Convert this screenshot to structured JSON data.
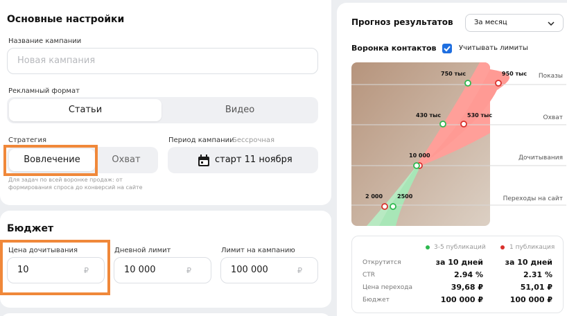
{
  "basic": {
    "title": "Основные настройки",
    "campaign_name_label": "Название кампании",
    "campaign_name_placeholder": "Новая кампания",
    "ad_format_label": "Рекламный формат",
    "format_options": [
      "Статьи",
      "Видео"
    ],
    "strategy_label": "Стратегия",
    "strategy_options": [
      "Вовлечение",
      "Охват"
    ],
    "strategy_hint": "Для задач по всей воронке продаж: от формирования спроса до конверсий на сайте",
    "period_label": "Период кампании",
    "period_sublabel": "Бессрочная",
    "period_button": "старт 11 ноября"
  },
  "budget": {
    "title": "Бюджет",
    "read_price_label": "Цена дочитывания",
    "read_price_value": "10",
    "daily_limit_label": "Дневной лимит",
    "daily_limit_value": "10 000",
    "campaign_limit_label": "Лимит на кампанию",
    "campaign_limit_value": "100 000",
    "currency": "₽"
  },
  "forecast": {
    "title": "Прогноз результатов",
    "period_select": "За месяц",
    "funnel_title": "Воронка контактов",
    "limits_checkbox_label": "Учитывать лимиты",
    "limits_checked": true,
    "stages": [
      "Показы",
      "Охват",
      "Дочитывания",
      "Переходы на сайт"
    ],
    "points_green": [
      "750 тыс",
      "430 тыс",
      "10 000",
      "2500"
    ],
    "points_red": [
      "950 тыс",
      "530 тыс",
      "",
      "2 000"
    ],
    "legend_green": "3-5 публикаций",
    "legend_red": "1 публикация",
    "color_green": "#2db84f",
    "color_red": "#d9302c",
    "color_accent": "#1f6fe0",
    "rows": [
      {
        "label": "Открутится",
        "green": "за 10 дней",
        "red": "за 10 дней"
      },
      {
        "label": "CTR",
        "green": "2.94 %",
        "red": "2.31 %"
      },
      {
        "label": "Цена перехода",
        "green": "39,68 ₽",
        "red": "51,01 ₽"
      },
      {
        "label": "Бюджет",
        "green": "100 000 ₽",
        "red": "100 000 ₽"
      }
    ]
  }
}
